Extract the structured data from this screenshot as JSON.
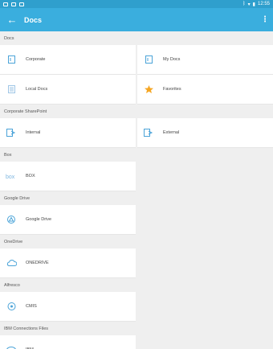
{
  "status_bar": {
    "time": "12:55"
  },
  "app_bar": {
    "title": "Docs"
  },
  "sections": [
    {
      "header": "Docs",
      "rows": [
        [
          {
            "label": "Corporate",
            "icon": "folder-doc-icon"
          },
          {
            "label": "My Docs",
            "icon": "folder-doc-icon"
          }
        ],
        [
          {
            "label": "Local Docs",
            "icon": "local-docs-icon"
          },
          {
            "label": "Favorites",
            "icon": "star-icon"
          }
        ]
      ]
    },
    {
      "header": "Corporate SharePoint",
      "rows": [
        [
          {
            "label": "Internal",
            "icon": "sharepoint-icon"
          },
          {
            "label": "External",
            "icon": "sharepoint-icon"
          }
        ]
      ]
    },
    {
      "header": "Box",
      "rows": [
        [
          {
            "label": "BOX",
            "icon": "box-icon"
          }
        ]
      ]
    },
    {
      "header": "Google Drive",
      "rows": [
        [
          {
            "label": "Google Drive",
            "icon": "google-drive-icon"
          }
        ]
      ]
    },
    {
      "header": "OneDrive",
      "rows": [
        [
          {
            "label": "ONEDRIVE",
            "icon": "cloud-icon"
          }
        ]
      ]
    },
    {
      "header": "Alfresco",
      "rows": [
        [
          {
            "label": "CMIS",
            "icon": "alfresco-icon"
          }
        ]
      ]
    },
    {
      "header": "IBM Connections Files",
      "rows": [
        [
          {
            "label": "IBM",
            "icon": "ibm-icon"
          }
        ]
      ]
    }
  ],
  "colors": {
    "accent": "#3aaede",
    "status": "#2f9fcd",
    "icon": "#4aa3d8",
    "star": "#f5a623"
  }
}
